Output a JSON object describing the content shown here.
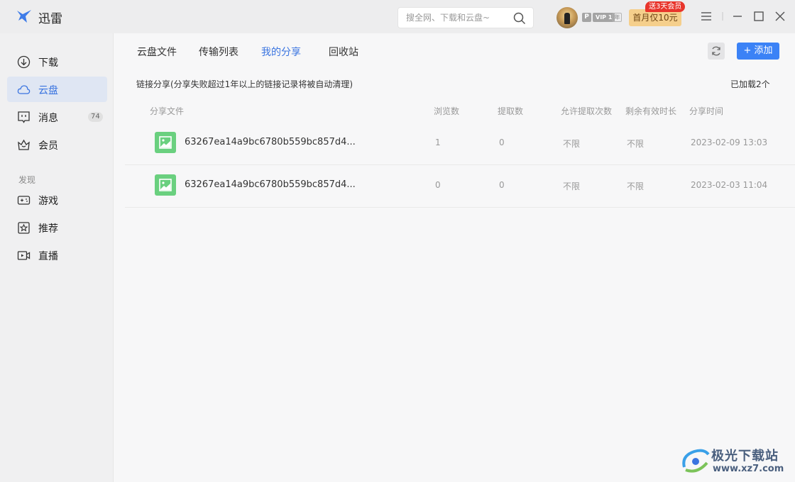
{
  "app": {
    "name": "迅雷"
  },
  "search": {
    "placeholder": "搜全网、下载和云盘~"
  },
  "user": {
    "badge_p": "P",
    "badge_vip": "VIP 1",
    "badge_year": "年",
    "promo_label": "首月仅10元",
    "promo_tag": "送3天会员"
  },
  "sidebar": {
    "items": [
      {
        "label": "下载",
        "icon": "download-icon"
      },
      {
        "label": "云盘",
        "icon": "cloud-icon",
        "active": true
      },
      {
        "label": "消息",
        "icon": "message-icon",
        "count": "74"
      },
      {
        "label": "会员",
        "icon": "crown-icon"
      }
    ],
    "discover_title": "发现",
    "discover_items": [
      {
        "label": "游戏",
        "icon": "gamepad-icon"
      },
      {
        "label": "推荐",
        "icon": "star-icon"
      },
      {
        "label": "直播",
        "icon": "live-video-icon"
      }
    ]
  },
  "tabs": [
    {
      "label": "云盘文件"
    },
    {
      "label": "传输列表"
    },
    {
      "label": "我的分享",
      "active": true
    },
    {
      "label": "回收站"
    }
  ],
  "toolbar": {
    "add_label": "+ 添加"
  },
  "share": {
    "notice": "链接分享(分享失败超过1年以上的链接记录将被自动清理)",
    "loaded": "已加载2个",
    "columns": [
      "分享文件",
      "浏览数",
      "提取数",
      "允许提取次数",
      "剩余有效时长",
      "分享时间"
    ],
    "rows": [
      {
        "name": "63267ea14a9bc6780b559bc857d4...",
        "views": "1",
        "downloads": "0",
        "allowed": "不限",
        "remaining": "不限",
        "time": "2023-02-09 13:03"
      },
      {
        "name": "63267ea14a9bc6780b559bc857d4...",
        "views": "0",
        "downloads": "0",
        "allowed": "不限",
        "remaining": "不限",
        "time": "2023-02-03 11:04"
      }
    ]
  },
  "watermark": {
    "title": "极光下载站",
    "url": "www.xz7.com"
  },
  "colors": {
    "accent": "#3a74e0",
    "add_button": "#3b82f6",
    "file_icon": "#6ad07f",
    "promo": "#f5cf8c",
    "promo_tag": "#e8352c"
  }
}
